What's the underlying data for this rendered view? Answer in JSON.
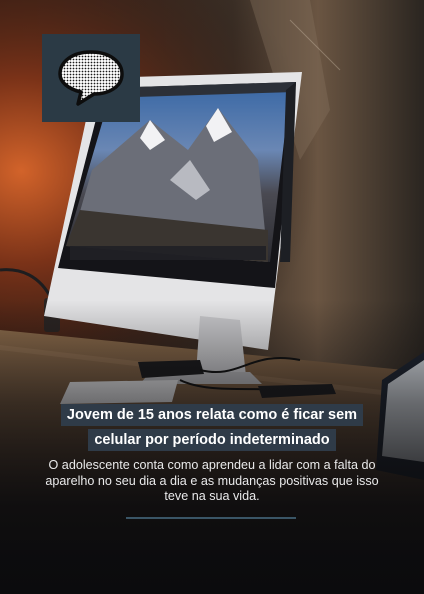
{
  "post": {
    "headline_line1": "Jovem de 15 anos relata como é ficar sem",
    "headline_line2": "celular por período indeterminado",
    "description": "O adolescente conta como aprendeu a lidar com a falta do aparelho no seu dia a dia e as mudanças positivas que isso teve na sua vida."
  },
  "icons": {
    "badge": "speech-bubble-icon"
  },
  "colors": {
    "badge_bg": "#2b3a45",
    "headline_bg": "#2f3b48",
    "divider": "#3a5566"
  }
}
